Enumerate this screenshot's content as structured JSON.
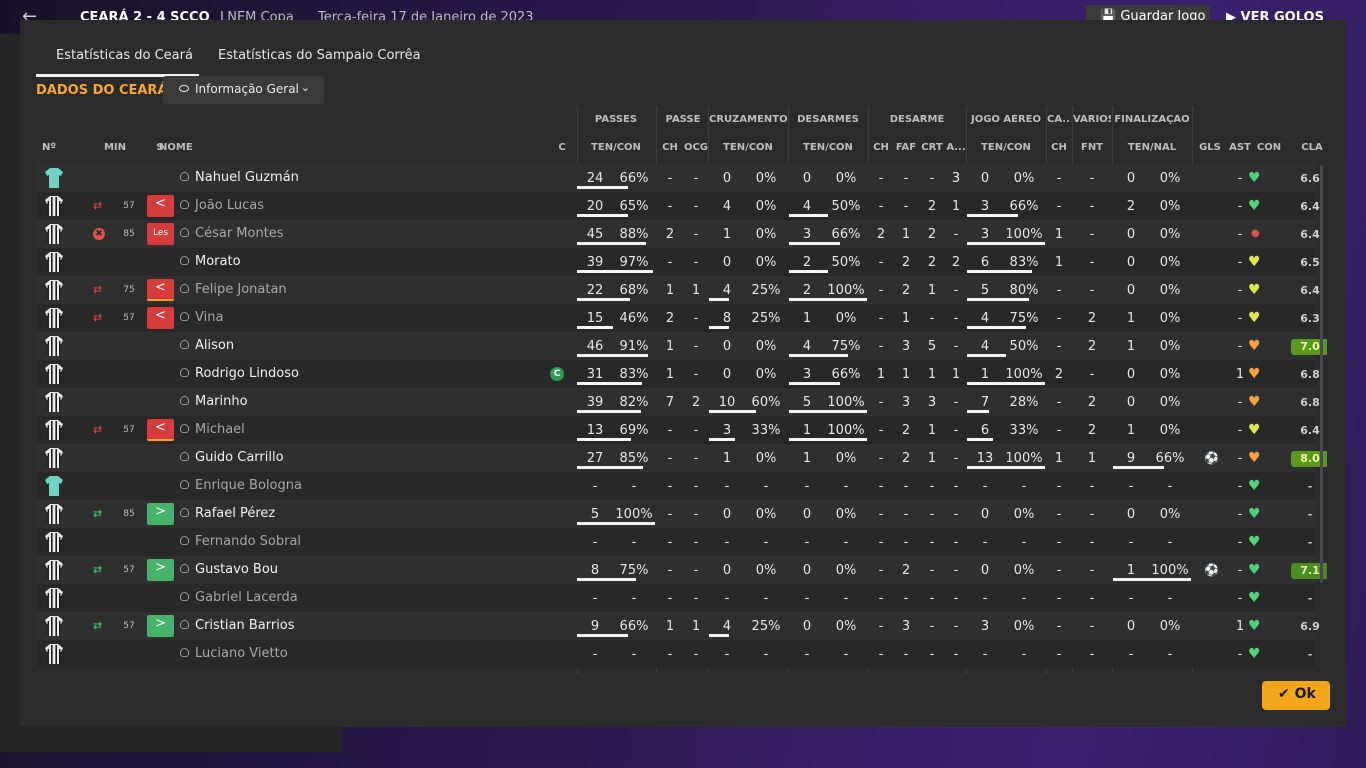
{
  "topbar": {
    "score": "CEARÁ 2 - 4 SCCO",
    "competition": "LNEM Copa",
    "date": "Terça-feira 17 de Janeiro de 2023",
    "save_label": "Guardar Jogo",
    "goals_label": "VER GOLOS"
  },
  "tabs": [
    "Estatísticas do Ceará",
    "Estatísticas do Sampaio Corrêa"
  ],
  "section_title": "DADOS DO CEARÁ",
  "view_select": "Informação Geral",
  "group_headers": [
    "PASSES",
    "PASSE",
    "CRUZAMENTOS",
    "DESARMES",
    "DESARME",
    "JOGO AÉREO",
    "CA...",
    "VÁRIOS",
    "FINALIZAÇÃO"
  ],
  "columns": [
    "Nº",
    "MIN",
    "S",
    "NOME",
    "C",
    "TEN/CON",
    "CH",
    "OCG",
    "TEN/CON",
    "TEN/CON",
    "CH",
    "FAF",
    "CRT",
    "A...",
    "TEN/CON",
    "CH",
    "FNT",
    "TEN/NAL",
    "GLS",
    "AST",
    "CON",
    "CLA"
  ],
  "colors": {
    "accent": "#f6a830",
    "ok": "#f2a71b",
    "green": "#4fd07a",
    "red": "#d63c3c"
  },
  "rows": [
    {
      "name": "Nahuel Guzmán",
      "dim": false,
      "gk": true,
      "sub": "",
      "min": "",
      "tag": "",
      "tag_style": "",
      "captain": false,
      "pass": [
        "24",
        "66%"
      ],
      "pass_bar": 0.66,
      "ch": "-",
      "ocg": "-",
      "cruz": [
        "0",
        "0%"
      ],
      "cruz_bar": 0,
      "des": [
        "0",
        "0%"
      ],
      "des_bar": 0,
      "d_ch": "-",
      "faf": "-",
      "crt": "-",
      "a": "3",
      "aer": [
        "0",
        "0%"
      ],
      "aer_bar": 0,
      "ca": "-",
      "fnt": "-",
      "fin": [
        "0",
        "0%"
      ],
      "fin_bar": 0,
      "gls": "",
      "ast": "-",
      "con": "green",
      "cla": "6.6",
      "cla_style": ""
    },
    {
      "name": "João Lucas",
      "dim": true,
      "gk": false,
      "sub": "out",
      "min": "57",
      "tag": "<",
      "tag_style": "red",
      "captain": false,
      "pass": [
        "20",
        "65%"
      ],
      "pass_bar": 0.65,
      "ch": "-",
      "ocg": "-",
      "cruz": [
        "4",
        "0%"
      ],
      "cruz_bar": 0,
      "des": [
        "4",
        "50%"
      ],
      "des_bar": 0.5,
      "d_ch": "-",
      "faf": "-",
      "crt": "2",
      "a": "1",
      "aer": [
        "3",
        "66%"
      ],
      "aer_bar": 0.66,
      "ca": "-",
      "fnt": "-",
      "fin": [
        "2",
        "0%"
      ],
      "fin_bar": 0,
      "gls": "",
      "ast": "-",
      "con": "green",
      "cla": "6.4",
      "cla_style": ""
    },
    {
      "name": "César Montes",
      "dim": true,
      "gk": false,
      "sub": "injury",
      "min": "85",
      "tag": "Les",
      "tag_style": "red",
      "captain": false,
      "pass": [
        "45",
        "88%"
      ],
      "pass_bar": 0.88,
      "ch": "2",
      "ocg": "-",
      "cruz": [
        "1",
        "0%"
      ],
      "cruz_bar": 0,
      "des": [
        "3",
        "66%"
      ],
      "des_bar": 0.66,
      "d_ch": "2",
      "faf": "1",
      "crt": "2",
      "a": "-",
      "aer": [
        "3",
        "100%"
      ],
      "aer_bar": 1,
      "ca": "1",
      "fnt": "-",
      "fin": [
        "0",
        "0%"
      ],
      "fin_bar": 0,
      "gls": "",
      "ast": "-",
      "con": "red",
      "cla": "6.4",
      "cla_style": ""
    },
    {
      "name": "Morato",
      "dim": false,
      "gk": false,
      "sub": "",
      "min": "",
      "tag": "",
      "tag_style": "",
      "captain": false,
      "pass": [
        "39",
        "97%"
      ],
      "pass_bar": 0.97,
      "ch": "-",
      "ocg": "-",
      "cruz": [
        "0",
        "0%"
      ],
      "cruz_bar": 0,
      "des": [
        "2",
        "50%"
      ],
      "des_bar": 0.5,
      "d_ch": "-",
      "faf": "2",
      "crt": "2",
      "a": "2",
      "aer": [
        "6",
        "83%"
      ],
      "aer_bar": 0.83,
      "ca": "1",
      "fnt": "-",
      "fin": [
        "0",
        "0%"
      ],
      "fin_bar": 0,
      "gls": "",
      "ast": "-",
      "con": "yellow",
      "cla": "6.5",
      "cla_style": ""
    },
    {
      "name": "Felipe Jonatan",
      "dim": true,
      "gk": false,
      "sub": "out",
      "min": "75",
      "tag": "<",
      "tag_style": "redorange",
      "captain": false,
      "pass": [
        "22",
        "68%"
      ],
      "pass_bar": 0.68,
      "ch": "1",
      "ocg": "1",
      "cruz": [
        "4",
        "25%"
      ],
      "cruz_bar": 0.25,
      "des": [
        "2",
        "100%"
      ],
      "des_bar": 1,
      "d_ch": "-",
      "faf": "2",
      "crt": "1",
      "a": "-",
      "aer": [
        "5",
        "80%"
      ],
      "aer_bar": 0.8,
      "ca": "-",
      "fnt": "-",
      "fin": [
        "0",
        "0%"
      ],
      "fin_bar": 0,
      "gls": "",
      "ast": "-",
      "con": "yellow",
      "cla": "6.4",
      "cla_style": ""
    },
    {
      "name": "Vina",
      "dim": true,
      "gk": false,
      "sub": "out",
      "min": "57",
      "tag": "<",
      "tag_style": "red",
      "captain": false,
      "pass": [
        "15",
        "46%"
      ],
      "pass_bar": 0.46,
      "ch": "2",
      "ocg": "-",
      "cruz": [
        "8",
        "25%"
      ],
      "cruz_bar": 0.25,
      "des": [
        "1",
        "0%"
      ],
      "des_bar": 0,
      "d_ch": "-",
      "faf": "1",
      "crt": "-",
      "a": "-",
      "aer": [
        "4",
        "75%"
      ],
      "aer_bar": 0.75,
      "ca": "-",
      "fnt": "2",
      "fin": [
        "1",
        "0%"
      ],
      "fin_bar": 0,
      "gls": "",
      "ast": "-",
      "con": "yellow",
      "cla": "6.3",
      "cla_style": ""
    },
    {
      "name": "Alison",
      "dim": false,
      "gk": false,
      "sub": "",
      "min": "",
      "tag": "",
      "tag_style": "",
      "captain": false,
      "pass": [
        "46",
        "91%"
      ],
      "pass_bar": 0.91,
      "ch": "1",
      "ocg": "-",
      "cruz": [
        "0",
        "0%"
      ],
      "cruz_bar": 0,
      "des": [
        "4",
        "75%"
      ],
      "des_bar": 0.75,
      "d_ch": "-",
      "faf": "3",
      "crt": "5",
      "a": "-",
      "aer": [
        "4",
        "50%"
      ],
      "aer_bar": 0.5,
      "ca": "-",
      "fnt": "2",
      "fin": [
        "1",
        "0%"
      ],
      "fin_bar": 0,
      "gls": "",
      "ast": "-",
      "con": "orange",
      "cla": "7.0",
      "cla_style": "hi"
    },
    {
      "name": "Rodrigo Lindoso",
      "dim": false,
      "gk": false,
      "sub": "",
      "min": "",
      "tag": "",
      "tag_style": "",
      "captain": true,
      "pass": [
        "31",
        "83%"
      ],
      "pass_bar": 0.83,
      "ch": "1",
      "ocg": "-",
      "cruz": [
        "0",
        "0%"
      ],
      "cruz_bar": 0,
      "des": [
        "3",
        "66%"
      ],
      "des_bar": 0.66,
      "d_ch": "1",
      "faf": "1",
      "crt": "1",
      "a": "1",
      "aer": [
        "1",
        "100%"
      ],
      "aer_bar": 1,
      "ca": "2",
      "fnt": "-",
      "fin": [
        "0",
        "0%"
      ],
      "fin_bar": 0,
      "gls": "",
      "ast": "1",
      "con": "orange",
      "cla": "6.8",
      "cla_style": ""
    },
    {
      "name": "Marinho",
      "dim": false,
      "gk": false,
      "sub": "",
      "min": "",
      "tag": "",
      "tag_style": "",
      "captain": false,
      "pass": [
        "39",
        "82%"
      ],
      "pass_bar": 0.82,
      "ch": "7",
      "ocg": "2",
      "cruz": [
        "10",
        "60%"
      ],
      "cruz_bar": 0.6,
      "des": [
        "5",
        "100%"
      ],
      "des_bar": 1,
      "d_ch": "-",
      "faf": "3",
      "crt": "3",
      "a": "-",
      "aer": [
        "7",
        "28%"
      ],
      "aer_bar": 0.28,
      "ca": "-",
      "fnt": "2",
      "fin": [
        "0",
        "0%"
      ],
      "fin_bar": 0,
      "gls": "",
      "ast": "-",
      "con": "orange",
      "cla": "6.8",
      "cla_style": ""
    },
    {
      "name": "Michael",
      "dim": true,
      "gk": false,
      "sub": "out",
      "min": "57",
      "tag": "<",
      "tag_style": "redorange",
      "captain": false,
      "pass": [
        "13",
        "69%"
      ],
      "pass_bar": 0.69,
      "ch": "-",
      "ocg": "-",
      "cruz": [
        "3",
        "33%"
      ],
      "cruz_bar": 0.33,
      "des": [
        "1",
        "100%"
      ],
      "des_bar": 1,
      "d_ch": "-",
      "faf": "2",
      "crt": "1",
      "a": "-",
      "aer": [
        "6",
        "33%"
      ],
      "aer_bar": 0.33,
      "ca": "-",
      "fnt": "2",
      "fin": [
        "1",
        "0%"
      ],
      "fin_bar": 0,
      "gls": "",
      "ast": "-",
      "con": "yellow",
      "cla": "6.4",
      "cla_style": ""
    },
    {
      "name": "Guido Carrillo",
      "dim": false,
      "gk": false,
      "sub": "",
      "min": "",
      "tag": "",
      "tag_style": "",
      "captain": false,
      "pass": [
        "27",
        "85%"
      ],
      "pass_bar": 0.85,
      "ch": "-",
      "ocg": "-",
      "cruz": [
        "1",
        "0%"
      ],
      "cruz_bar": 0,
      "des": [
        "1",
        "0%"
      ],
      "des_bar": 0,
      "d_ch": "-",
      "faf": "2",
      "crt": "1",
      "a": "-",
      "aer": [
        "13",
        "100%"
      ],
      "aer_bar": 1,
      "ca": "1",
      "fnt": "1",
      "fin": [
        "9",
        "66%"
      ],
      "fin_bar": 0.66,
      "gls": "ball",
      "ast": "-",
      "con": "orange",
      "cla": "8.0",
      "cla_style": "hi"
    },
    {
      "name": "Enrique Bologna",
      "dim": true,
      "gk": true,
      "sub": "",
      "min": "",
      "tag": "",
      "tag_style": "",
      "captain": false,
      "pass": [
        "-",
        "-"
      ],
      "pass_bar": 0,
      "ch": "-",
      "ocg": "-",
      "cruz": [
        "-",
        "-"
      ],
      "cruz_bar": 0,
      "des": [
        "-",
        "-"
      ],
      "des_bar": 0,
      "d_ch": "-",
      "faf": "-",
      "crt": "-",
      "a": "-",
      "aer": [
        "-",
        "-"
      ],
      "aer_bar": 0,
      "ca": "-",
      "fnt": "-",
      "fin": [
        "-",
        "-"
      ],
      "fin_bar": 0,
      "gls": "",
      "ast": "-",
      "con": "green",
      "cla": "-",
      "cla_style": ""
    },
    {
      "name": "Rafael Pérez",
      "dim": false,
      "gk": false,
      "sub": "in",
      "min": "85",
      "tag": ">",
      "tag_style": "green",
      "captain": false,
      "pass": [
        "5",
        "100%"
      ],
      "pass_bar": 1,
      "ch": "-",
      "ocg": "-",
      "cruz": [
        "0",
        "0%"
      ],
      "cruz_bar": 0,
      "des": [
        "0",
        "0%"
      ],
      "des_bar": 0,
      "d_ch": "-",
      "faf": "-",
      "crt": "-",
      "a": "-",
      "aer": [
        "0",
        "0%"
      ],
      "aer_bar": 0,
      "ca": "-",
      "fnt": "-",
      "fin": [
        "0",
        "0%"
      ],
      "fin_bar": 0,
      "gls": "",
      "ast": "-",
      "con": "green",
      "cla": "-",
      "cla_style": ""
    },
    {
      "name": "Fernando Sobral",
      "dim": true,
      "gk": false,
      "sub": "",
      "min": "",
      "tag": "",
      "tag_style": "",
      "captain": false,
      "pass": [
        "-",
        "-"
      ],
      "pass_bar": 0,
      "ch": "-",
      "ocg": "-",
      "cruz": [
        "-",
        "-"
      ],
      "cruz_bar": 0,
      "des": [
        "-",
        "-"
      ],
      "des_bar": 0,
      "d_ch": "-",
      "faf": "-",
      "crt": "-",
      "a": "-",
      "aer": [
        "-",
        "-"
      ],
      "aer_bar": 0,
      "ca": "-",
      "fnt": "-",
      "fin": [
        "-",
        "-"
      ],
      "fin_bar": 0,
      "gls": "",
      "ast": "-",
      "con": "green",
      "cla": "-",
      "cla_style": ""
    },
    {
      "name": "Gustavo Bou",
      "dim": false,
      "gk": false,
      "sub": "in",
      "min": "57",
      "tag": ">",
      "tag_style": "green",
      "captain": false,
      "pass": [
        "8",
        "75%"
      ],
      "pass_bar": 0.75,
      "ch": "-",
      "ocg": "-",
      "cruz": [
        "0",
        "0%"
      ],
      "cruz_bar": 0,
      "des": [
        "0",
        "0%"
      ],
      "des_bar": 0,
      "d_ch": "-",
      "faf": "2",
      "crt": "-",
      "a": "-",
      "aer": [
        "0",
        "0%"
      ],
      "aer_bar": 0,
      "ca": "-",
      "fnt": "-",
      "fin": [
        "1",
        "100%"
      ],
      "fin_bar": 1,
      "gls": "ball",
      "ast": "-",
      "con": "green",
      "cla": "7.1",
      "cla_style": "mid"
    },
    {
      "name": "Gabriel Lacerda",
      "dim": true,
      "gk": false,
      "sub": "",
      "min": "",
      "tag": "",
      "tag_style": "",
      "captain": false,
      "pass": [
        "-",
        "-"
      ],
      "pass_bar": 0,
      "ch": "-",
      "ocg": "-",
      "cruz": [
        "-",
        "-"
      ],
      "cruz_bar": 0,
      "des": [
        "-",
        "-"
      ],
      "des_bar": 0,
      "d_ch": "-",
      "faf": "-",
      "crt": "-",
      "a": "-",
      "aer": [
        "-",
        "-"
      ],
      "aer_bar": 0,
      "ca": "-",
      "fnt": "-",
      "fin": [
        "-",
        "-"
      ],
      "fin_bar": 0,
      "gls": "",
      "ast": "-",
      "con": "green",
      "cla": "-",
      "cla_style": ""
    },
    {
      "name": "Cristian Barrios",
      "dim": false,
      "gk": false,
      "sub": "in",
      "min": "57",
      "tag": ">",
      "tag_style": "green",
      "captain": false,
      "pass": [
        "9",
        "66%"
      ],
      "pass_bar": 0.66,
      "ch": "1",
      "ocg": "1",
      "cruz": [
        "4",
        "25%"
      ],
      "cruz_bar": 0.25,
      "des": [
        "0",
        "0%"
      ],
      "des_bar": 0,
      "d_ch": "-",
      "faf": "3",
      "crt": "-",
      "a": "-",
      "aer": [
        "3",
        "0%"
      ],
      "aer_bar": 0,
      "ca": "-",
      "fnt": "-",
      "fin": [
        "0",
        "0%"
      ],
      "fin_bar": 0,
      "gls": "",
      "ast": "1",
      "con": "green",
      "cla": "6.9",
      "cla_style": ""
    },
    {
      "name": "Luciano Vietto",
      "dim": true,
      "gk": false,
      "sub": "",
      "min": "",
      "tag": "",
      "tag_style": "",
      "captain": false,
      "pass": [
        "-",
        "-"
      ],
      "pass_bar": 0,
      "ch": "-",
      "ocg": "-",
      "cruz": [
        "-",
        "-"
      ],
      "cruz_bar": 0,
      "des": [
        "-",
        "-"
      ],
      "des_bar": 0,
      "d_ch": "-",
      "faf": "-",
      "crt": "-",
      "a": "-",
      "aer": [
        "-",
        "-"
      ],
      "aer_bar": 0,
      "ca": "-",
      "fnt": "-",
      "fin": [
        "-",
        "-"
      ],
      "fin_bar": 0,
      "gls": "",
      "ast": "-",
      "con": "green",
      "cla": "-",
      "cla_style": ""
    }
  ],
  "ok_label": "Ok"
}
